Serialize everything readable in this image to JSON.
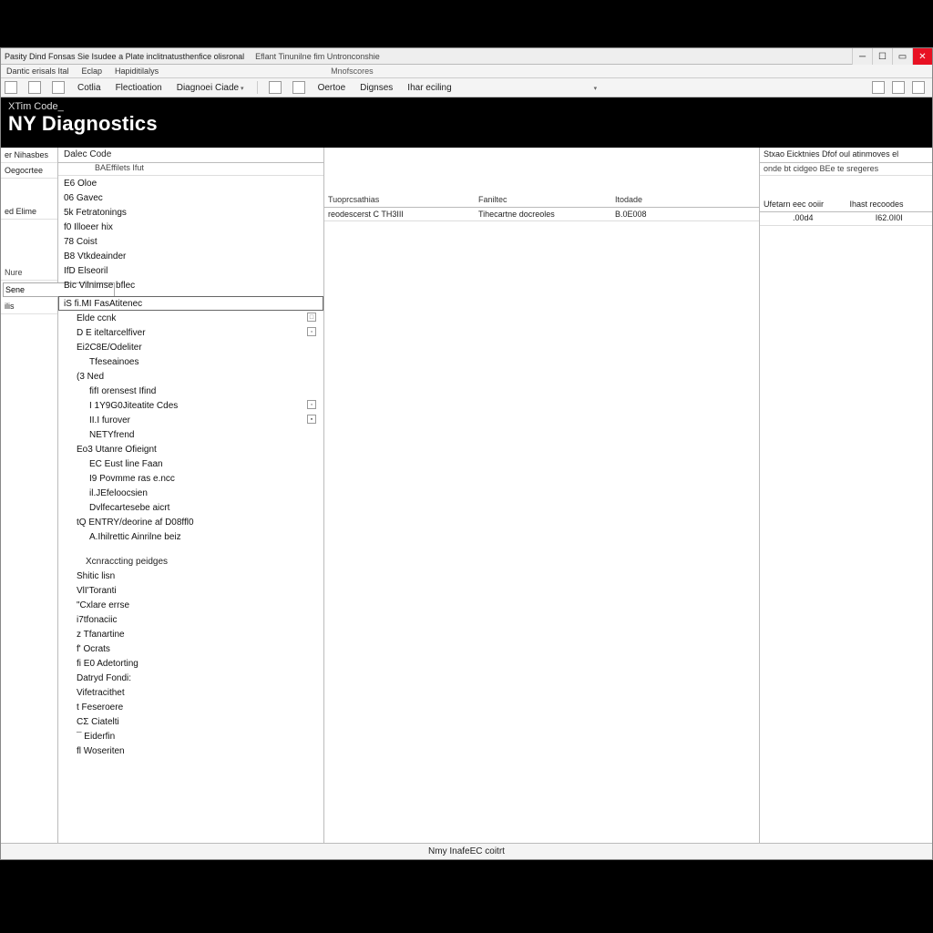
{
  "titlebar": {
    "left_a": "Pasity Dind Fonsas Sie Isudee a Plate inclitnatusthenfice olisronal",
    "left_b": "Eflant Tinunilne fim Untronconshie"
  },
  "menubar": {
    "a": "Dantic erisals Ital",
    "b": "Eclap",
    "c": "Hapiditilalys",
    "d": "Mnofscores"
  },
  "toolbar": {
    "t1": "Cotlia",
    "t2": "Flectioation",
    "t3": "Diagnoei Ciade",
    "t4": "Oertoe",
    "t5": "Dignses",
    "t6": "Ihar eciling"
  },
  "blackbar": {
    "breadcrumb": "XTim Code_",
    "title": "NY Diagnostics"
  },
  "sidebar": {
    "a": "er Nihasbes",
    "b": "Oegocrtee",
    "c": "ed Elime",
    "d_label": "Nure",
    "d_value": "Sene",
    "e": "ilis"
  },
  "tree": {
    "header": "Dalec Code",
    "sub": "BAEffilets Ifut",
    "root": [
      "E6 Oloe",
      "06 Gavec",
      "5k Fetratonings",
      "f0 Illoeer hix",
      "78 Coist",
      "B8 Vtkdeainder",
      "IfD Elseoril",
      "Bic Vilnimse bflec"
    ],
    "selected": "iS fi.MI FasAtitenec",
    "group1": [
      {
        "t": "Elde ccnk",
        "b": "□"
      },
      {
        "t": "D E iteltarcelfiver",
        "b": "▫"
      },
      {
        "t": "Ei2C8E/Odeliter",
        "b": ""
      },
      {
        "t": "Tfeseainoes",
        "b": ""
      }
    ],
    "ned": "(3 Ned",
    "group2": [
      {
        "t": "fifI orensest Ifind",
        "b": ""
      },
      {
        "t": "I 1Y9G0Jiteatite Cdes",
        "b": "▫"
      },
      {
        "t": "II.I furover",
        "b": "▪"
      },
      {
        "t": "NETYfrend",
        "b": "·"
      }
    ],
    "group3_head": "Eo3 Utanre Ofieignt",
    "group3": [
      "EC Eust line Faan",
      "I9 Povmme ras e.ncc",
      "il.JEfeloocsien",
      "Dvlfecartesebe aicrt"
    ],
    "entry": "tQ ENTRY/deorine af D08ffl0",
    "entry_sub": "A.Ihilrettic Ainrilne beiz",
    "section": "Xcnraccting peidges",
    "group4": [
      "Shitic lisn",
      "VlI'Toranti",
      "\"Cxlare errse",
      "i7tfonaciic",
      "z Tfanartine",
      "f' Ocrats",
      "fi E0 Adetorting",
      "Datryd Fondi:",
      "Vifetracithet",
      "t Feseroere",
      "CΣ Ciatelti",
      "¯ Eiderfin",
      "fl Woseriten"
    ]
  },
  "grid": {
    "h1": "Tuoprcsathias",
    "h2": "Faniltec",
    "h3": "Itodade",
    "r1_c1": "reodescerst C TH3III",
    "r1_c2": "Tihecartne docreoles",
    "r1_c3": "B.0E008"
  },
  "rightpanel": {
    "head": "Stxao Eicktnies Dfof oul atinmoves el",
    "sub": "onde bt cidgeo BEe te sregeres",
    "c1": "Ufetarn eec ooiir",
    "c2": "Ihast recoodes",
    "v1": ".00d4",
    "v2": "I62.0I0I"
  },
  "status": "Nmy InafeEC coitrt"
}
